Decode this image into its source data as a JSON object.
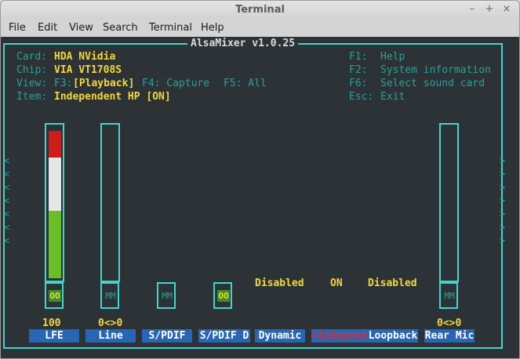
{
  "window": {
    "title": "Terminal",
    "controls": [
      "–",
      "+",
      "×"
    ]
  },
  "menu": [
    "File",
    "Edit",
    "View",
    "Search",
    "Terminal",
    "Help"
  ],
  "alsamixer": {
    "title": "AlsaMixer v1.0.25",
    "card_label": "Card:",
    "card_value": "HDA NVidia",
    "chip_label": "Chip:",
    "chip_value": "VIA VT1708S",
    "view_label": "View:",
    "view_f3": "F3:",
    "view_playback": "[Playback]",
    "view_f4": "F4: Capture",
    "view_f5": "F5: All",
    "item_label": "Item:",
    "item_value": "Independent HP [ON]",
    "help": [
      {
        "key": "F1:",
        "text": "Help"
      },
      {
        "key": "F2:",
        "text": "System information"
      },
      {
        "key": "F6:",
        "text": "Select sound card"
      },
      {
        "key": "Esc:",
        "text": "Exit"
      }
    ],
    "left_arrow": "<",
    "right_arrow": ">",
    "status_disabled_1": "Disabled",
    "status_on": "ON",
    "status_disabled_2": "Disabled",
    "channels": [
      {
        "name": "LFE",
        "value": "100",
        "mute": "OO",
        "level": 1.0
      },
      {
        "name": "Line",
        "value": "0<>0",
        "mute": "MM",
        "level": 0.0
      },
      {
        "name": "S/PDIF",
        "value": "",
        "mute": "MM"
      },
      {
        "name": "S/PDIF D",
        "value": "",
        "mute": "OO"
      },
      {
        "name": "Dynamic",
        "value": ""
      },
      {
        "name": "<Independ>",
        "value": "",
        "selected": true
      },
      {
        "name": "Loopback",
        "value": ""
      },
      {
        "name": "Rear Mic",
        "value": "0<>0",
        "mute": "MM",
        "level": 0.0
      }
    ],
    "colors": {
      "background": "#2c3235",
      "border": "#3fd6d0",
      "teal_text": "#26a39a",
      "yellow_text": "#f2d83c",
      "label_bg": "#2866b3",
      "selected_text": "#e32b2b",
      "level_red": "#d11c1c",
      "level_white": "#e6e6e6",
      "level_green": "#6bbf26"
    }
  }
}
